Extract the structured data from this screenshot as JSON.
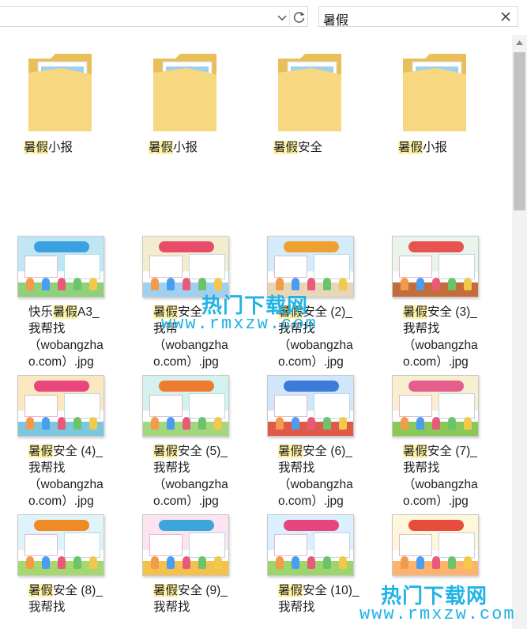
{
  "toolbar": {
    "search_query": "暑假",
    "icons": {
      "dropdown": "chevron-down-icon",
      "refresh": "refresh-icon",
      "clear": "close-icon"
    }
  },
  "folders": [
    {
      "label_hl": "暑假",
      "label_rest": "小报"
    },
    {
      "label_hl": "暑假",
      "label_rest": "小报"
    },
    {
      "label_hl": "暑假",
      "label_rest": "安全"
    },
    {
      "label_hl": "暑假",
      "label_rest": "小报"
    }
  ],
  "files": [
    {
      "line1_pre": "快乐",
      "line1_hl": "暑假",
      "line1_post": "A3_",
      "line2": "我帮找",
      "line3": "（wobangzha",
      "line4": "o.com）.jpg",
      "thumb_colors": {
        "sky": "#bfe6f5",
        "banner": "#3aa0e0",
        "ground": "#8fd07a"
      }
    },
    {
      "line1_pre": "",
      "line1_hl": "暑假",
      "line1_post": "安全",
      "line2": "我帮",
      "line3": "（wobangzha",
      "line4": "o.com）.jpg",
      "thumb_colors": {
        "sky": "#f3edd0",
        "banner": "#e84c6a",
        "ground": "#9fd0ef"
      }
    },
    {
      "line1_pre": "",
      "line1_hl": "暑假",
      "line1_post": "安全 (2)_",
      "line2": "我帮找",
      "line3": "（wobangzha",
      "line4": "o.com）.jpg",
      "thumb_colors": {
        "sky": "#d4ecfa",
        "banner": "#f0a030",
        "ground": "#e7d7b8"
      }
    },
    {
      "line1_pre": "",
      "line1_hl": "暑假",
      "line1_post": "安全 (3)_",
      "line2": "我帮找",
      "line3": "（wobangzha",
      "line4": "o.com）.jpg",
      "thumb_colors": {
        "sky": "#e9f4ea",
        "banner": "#e8524f",
        "ground": "#c46c3a"
      }
    },
    {
      "line1_pre": "",
      "line1_hl": "暑假",
      "line1_post": "安全 (4)_",
      "line2": "我帮找",
      "line3": "（wobangzha",
      "line4": "o.com）.jpg",
      "thumb_colors": {
        "sky": "#fbe7c0",
        "banner": "#e8467c",
        "ground": "#7cc7e0"
      }
    },
    {
      "line1_pre": "",
      "line1_hl": "暑假",
      "line1_post": "安全 (5)_",
      "line2": "我帮找",
      "line3": "（wobangzha",
      "line4": "o.com）.jpg",
      "thumb_colors": {
        "sky": "#d3f1ee",
        "banner": "#ef7b2f",
        "ground": "#a3d77c"
      }
    },
    {
      "line1_pre": "",
      "line1_hl": "暑假",
      "line1_post": "安全 (6)_",
      "line2": "我帮找",
      "line3": "（wobangzha",
      "line4": "o.com）.jpg",
      "thumb_colors": {
        "sky": "#cfe6fb",
        "banner": "#3d7bd8",
        "ground": "#e05a4a"
      }
    },
    {
      "line1_pre": "",
      "line1_hl": "暑假",
      "line1_post": "安全 (7)_",
      "line2": "我帮找",
      "line3": "（wobangzha",
      "line4": "o.com）.jpg",
      "thumb_colors": {
        "sky": "#f8efd0",
        "banner": "#e55d8c",
        "ground": "#8ac858"
      }
    },
    {
      "line1_pre": "",
      "line1_hl": "暑假",
      "line1_post": "安全 (8)_",
      "line2": "我帮找",
      "line3": "",
      "line4": "",
      "thumb_colors": {
        "sky": "#dff3fb",
        "banner": "#f08a24",
        "ground": "#a5d86e"
      }
    },
    {
      "line1_pre": "",
      "line1_hl": "暑假",
      "line1_post": "安全 (9)_",
      "line2": "我帮找",
      "line3": "",
      "line4": "",
      "thumb_colors": {
        "sky": "#fbe3ef",
        "banner": "#3ba6dc",
        "ground": "#f4c24a"
      }
    },
    {
      "line1_pre": "",
      "line1_hl": "暑假",
      "line1_post": "安全 (10)_",
      "line2": "我帮找",
      "line3": "",
      "line4": "",
      "thumb_colors": {
        "sky": "#dcefff",
        "banner": "#e6457a",
        "ground": "#9bd56b"
      }
    },
    {
      "line1_pre": "",
      "line1_hl": "",
      "line1_post": "",
      "line2": "",
      "line3": "",
      "line4": "",
      "thumb_colors": {
        "sky": "#fff7dc",
        "banner": "#e84c3c",
        "ground": "#ffb26b"
      }
    }
  ],
  "watermarks": [
    {
      "title": "热门下载网",
      "url": "www.rmxzw.com"
    },
    {
      "title": "热门下载网",
      "url": "www.rmxzw.com"
    }
  ],
  "colors": {
    "highlight": "#fff3a8",
    "watermark": "#20b3e6",
    "folder": "#f5d37a"
  }
}
